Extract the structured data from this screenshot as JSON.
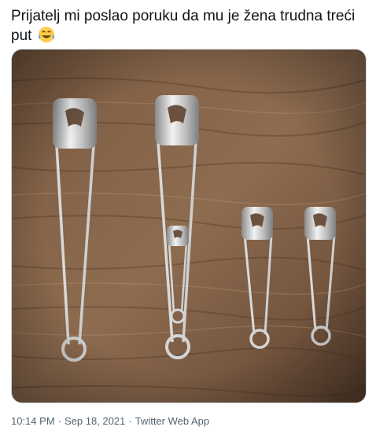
{
  "tweet": {
    "text": "Prijatelj mi poslao poruku da mu je žena trudna treći put",
    "emoji": "face-with-tears-of-joy-icon"
  },
  "media": {
    "description_icon": "safety-pins-photo"
  },
  "meta": {
    "time": "10:14 PM",
    "separator": "·",
    "date": "Sep 18, 2021",
    "client": "Twitter Web App"
  },
  "colors": {
    "text": "#0f1419",
    "meta": "#536471",
    "wood_dark": "#5a3f2b",
    "wood_light": "#9c7a5c"
  }
}
